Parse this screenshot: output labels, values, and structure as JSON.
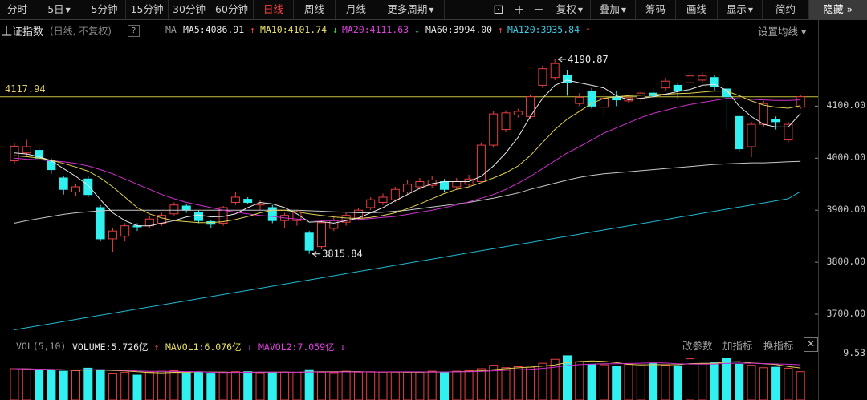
{
  "toolbar": {
    "tabs": [
      {
        "label": "分时",
        "dropdown": false,
        "active": false
      },
      {
        "label": "5日",
        "dropdown": true,
        "active": false
      },
      {
        "label": "5分钟",
        "dropdown": false,
        "active": false
      },
      {
        "label": "15分钟",
        "dropdown": false,
        "active": false
      },
      {
        "label": "30分钟",
        "dropdown": false,
        "active": false
      },
      {
        "label": "60分钟",
        "dropdown": false,
        "active": false
      },
      {
        "label": "日线",
        "dropdown": false,
        "active": true
      },
      {
        "label": "周线",
        "dropdown": false,
        "active": false
      },
      {
        "label": "月线",
        "dropdown": false,
        "active": false
      },
      {
        "label": "更多周期",
        "dropdown": true,
        "active": false
      }
    ],
    "tools": [
      {
        "label": "复权",
        "dropdown": true
      },
      {
        "label": "叠加",
        "dropdown": true
      },
      {
        "label": "筹码",
        "dropdown": false
      },
      {
        "label": "画线",
        "dropdown": false
      },
      {
        "label": "显示",
        "dropdown": true
      },
      {
        "label": "简约",
        "dropdown": false
      }
    ],
    "hide_label": "隐藏",
    "hide_arrows": "»"
  },
  "ma_bar": {
    "index_name": "上证指数",
    "mode": "(日线, 不复权)",
    "help": "?",
    "ma_title": "MA",
    "ma5": {
      "text": "MA5:4086.91",
      "arrow": "↑",
      "color": "#e8e8e8"
    },
    "ma10": {
      "text": "MA10:4101.74",
      "arrow": "↓",
      "color": "#e8e060"
    },
    "ma20": {
      "text": "MA20:4111.63",
      "arrow": "↓",
      "color": "#e040e0"
    },
    "ma60": {
      "text": "MA60:3994.00",
      "arrow": "↑",
      "color": "#e8e8e8"
    },
    "ma120": {
      "text": "MA120:3935.84",
      "arrow": "↑",
      "color": "#38d0e8"
    },
    "settings": "设置均线 ▾"
  },
  "price_line_label": "4117.94",
  "annotations": {
    "high": "4190.87",
    "low": "3815.84"
  },
  "y_axis": {
    "ticks": [
      "4100.00",
      "4000.00",
      "3900.00",
      "3800.00",
      "3700.00"
    ],
    "vol_tick": "9.53"
  },
  "vol_bar": {
    "title": "VOL(5,10)",
    "volume": {
      "text": "VOLUME:5.726亿",
      "arrow": "↑"
    },
    "mavol1": {
      "text": "MAVOL1:6.076亿",
      "arrow": "↓"
    },
    "mavol2": {
      "text": "MAVOL2:7.059亿",
      "arrow": "↓"
    },
    "buttons": [
      "改参数",
      "加指标",
      "换指标"
    ],
    "close": "✕"
  },
  "colors": {
    "up": "#e84040",
    "down": "#30f0f0",
    "ma5": "#e8e8e8",
    "ma10": "#e0d050",
    "ma20": "#d030d0",
    "ma60": "#c8c8c8",
    "ma120": "#20b8d0",
    "price_line": "#c8c040"
  },
  "chart_data": {
    "type": "candlestick",
    "ylim": [
      3660,
      4230
    ],
    "candles": [
      {
        "o": 3995,
        "c": 4023,
        "h": 4028,
        "l": 3990
      },
      {
        "o": 4010,
        "c": 4022,
        "h": 4035,
        "l": 4005
      },
      {
        "o": 4015,
        "c": 4000,
        "h": 4020,
        "l": 3995
      },
      {
        "o": 3995,
        "c": 3978,
        "h": 4000,
        "l": 3970
      },
      {
        "o": 3962,
        "c": 3940,
        "h": 3965,
        "l": 3930
      },
      {
        "o": 3935,
        "c": 3945,
        "h": 3950,
        "l": 3928
      },
      {
        "o": 3960,
        "c": 3930,
        "h": 3965,
        "l": 3925
      },
      {
        "o": 3905,
        "c": 3845,
        "h": 3910,
        "l": 3840
      },
      {
        "o": 3845,
        "c": 3860,
        "h": 3865,
        "l": 3820
      },
      {
        "o": 3850,
        "c": 3870,
        "h": 3875,
        "l": 3840
      },
      {
        "o": 3870,
        "c": 3868,
        "h": 3875,
        "l": 3860
      },
      {
        "o": 3870,
        "c": 3883,
        "h": 3890,
        "l": 3865
      },
      {
        "o": 3875,
        "c": 3890,
        "h": 3895,
        "l": 3870
      },
      {
        "o": 3893,
        "c": 3910,
        "h": 3915,
        "l": 3890
      },
      {
        "o": 3908,
        "c": 3900,
        "h": 3912,
        "l": 3895
      },
      {
        "o": 3895,
        "c": 3880,
        "h": 3900,
        "l": 3875
      },
      {
        "o": 3878,
        "c": 3873,
        "h": 3882,
        "l": 3866
      },
      {
        "o": 3875,
        "c": 3905,
        "h": 3908,
        "l": 3870
      },
      {
        "o": 3915,
        "c": 3925,
        "h": 3935,
        "l": 3910
      },
      {
        "o": 3921,
        "c": 3915,
        "h": 3925,
        "l": 3912
      },
      {
        "o": 3910,
        "c": 3912,
        "h": 3920,
        "l": 3900
      },
      {
        "o": 3905,
        "c": 3880,
        "h": 3910,
        "l": 3875
      },
      {
        "o": 3880,
        "c": 3890,
        "h": 3895,
        "l": 3866
      },
      {
        "o": 3880,
        "c": 3897,
        "h": 3900,
        "l": 3870
      },
      {
        "o": 3856,
        "c": 3823,
        "h": 3860,
        "l": 3816
      },
      {
        "o": 3830,
        "c": 3876,
        "h": 3880,
        "l": 3825
      },
      {
        "o": 3865,
        "c": 3880,
        "h": 3890,
        "l": 3860
      },
      {
        "o": 3877,
        "c": 3890,
        "h": 3895,
        "l": 3870
      },
      {
        "o": 3885,
        "c": 3900,
        "h": 3905,
        "l": 3880
      },
      {
        "o": 3905,
        "c": 3920,
        "h": 3925,
        "l": 3900
      },
      {
        "o": 3915,
        "c": 3925,
        "h": 3932,
        "l": 3910
      },
      {
        "o": 3920,
        "c": 3940,
        "h": 3945,
        "l": 3915
      },
      {
        "o": 3935,
        "c": 3950,
        "h": 3958,
        "l": 3930
      },
      {
        "o": 3945,
        "c": 3955,
        "h": 3962,
        "l": 3940
      },
      {
        "o": 3948,
        "c": 3958,
        "h": 3965,
        "l": 3942
      },
      {
        "o": 3955,
        "c": 3940,
        "h": 3960,
        "l": 3935
      },
      {
        "o": 3945,
        "c": 3955,
        "h": 3962,
        "l": 3940
      },
      {
        "o": 3950,
        "c": 3960,
        "h": 3968,
        "l": 3946
      },
      {
        "o": 3955,
        "c": 4025,
        "h": 4030,
        "l": 3955
      },
      {
        "o": 4025,
        "c": 4085,
        "h": 4090,
        "l": 4020
      },
      {
        "o": 4055,
        "c": 4087,
        "h": 4092,
        "l": 4050
      },
      {
        "o": 4083,
        "c": 4090,
        "h": 4095,
        "l": 4078
      },
      {
        "o": 4080,
        "c": 4118,
        "h": 4122,
        "l": 4075
      },
      {
        "o": 4140,
        "c": 4172,
        "h": 4178,
        "l": 4135
      },
      {
        "o": 4155,
        "c": 4182,
        "h": 4190,
        "l": 4150
      },
      {
        "o": 4160,
        "c": 4145,
        "h": 4170,
        "l": 4120
      },
      {
        "o": 4105,
        "c": 4117,
        "h": 4125,
        "l": 4100
      },
      {
        "o": 4128,
        "c": 4100,
        "h": 4135,
        "l": 4095
      },
      {
        "o": 4098,
        "c": 4115,
        "h": 4120,
        "l": 4080
      },
      {
        "o": 4118,
        "c": 4112,
        "h": 4130,
        "l": 4100
      },
      {
        "o": 4110,
        "c": 4116,
        "h": 4122,
        "l": 4105
      },
      {
        "o": 4115,
        "c": 4125,
        "h": 4130,
        "l": 4108
      },
      {
        "o": 4125,
        "c": 4120,
        "h": 4135,
        "l": 4115
      },
      {
        "o": 4135,
        "c": 4148,
        "h": 4155,
        "l": 4130
      },
      {
        "o": 4140,
        "c": 4130,
        "h": 4145,
        "l": 4115
      },
      {
        "o": 4145,
        "c": 4158,
        "h": 4162,
        "l": 4140
      },
      {
        "o": 4150,
        "c": 4158,
        "h": 4165,
        "l": 4145
      },
      {
        "o": 4155,
        "c": 4138,
        "h": 4160,
        "l": 4130
      },
      {
        "o": 4133,
        "c": 4118,
        "h": 4135,
        "l": 4055
      },
      {
        "o": 4080,
        "c": 4018,
        "h": 4082,
        "l": 4012
      },
      {
        "o": 4022,
        "c": 4065,
        "h": 4070,
        "l": 4002
      },
      {
        "o": 4065,
        "c": 4105,
        "h": 4110,
        "l": 4060
      },
      {
        "o": 4075,
        "c": 4070,
        "h": 4080,
        "l": 4055
      },
      {
        "o": 4035,
        "c": 4065,
        "h": 4070,
        "l": 4030
      },
      {
        "o": 4098,
        "c": 4118,
        "h": 4122,
        "l": 4095
      }
    ],
    "volume": [
      6.3,
      6.2,
      6.1,
      6.0,
      5.8,
      5.9,
      6.4,
      6.1,
      5.4,
      5.6,
      5.0,
      5.6,
      5.8,
      5.9,
      5.5,
      5.6,
      5.4,
      5.6,
      5.7,
      5.7,
      5.5,
      5.5,
      5.6,
      5.6,
      6.1,
      5.6,
      5.5,
      5.8,
      5.6,
      5.7,
      5.6,
      5.6,
      5.6,
      5.6,
      5.8,
      5.6,
      5.8,
      5.9,
      6.3,
      7.0,
      6.5,
      6.7,
      6.6,
      7.4,
      8.2,
      8.9,
      7.7,
      7.1,
      7.1,
      6.8,
      7.2,
      7.1,
      7.4,
      7.0,
      6.9,
      8.3,
      7.3,
      7.5,
      8.4,
      7.2,
      7.0,
      6.5,
      6.6,
      6.4,
      5.7
    ],
    "vol_ylim": [
      0,
      9.53
    ],
    "ma5": [
      4010,
      4008,
      4003,
      3995,
      3980,
      3965,
      3948,
      3920,
      3895,
      3880,
      3870,
      3870,
      3875,
      3880,
      3887,
      3891,
      3887,
      3888,
      3893,
      3905,
      3915,
      3912,
      3905,
      3893,
      3877,
      3878,
      3875,
      3880,
      3885,
      3895,
      3905,
      3918,
      3930,
      3942,
      3951,
      3955,
      3955,
      3955,
      3965,
      3985,
      4010,
      4040,
      4080,
      4115,
      4140,
      4150,
      4145,
      4140,
      4135,
      4120,
      4112,
      4115,
      4118,
      4123,
      4128,
      4132,
      4140,
      4142,
      4130,
      4100,
      4080,
      4065,
      4060,
      4060,
      4086
    ],
    "ma10": [
      4005,
      4003,
      4000,
      3996,
      3990,
      3983,
      3975,
      3962,
      3945,
      3925,
      3905,
      3893,
      3885,
      3880,
      3878,
      3876,
      3876,
      3878,
      3882,
      3888,
      3895,
      3900,
      3900,
      3897,
      3893,
      3890,
      3887,
      3885,
      3884,
      3886,
      3890,
      3895,
      3903,
      3912,
      3922,
      3932,
      3940,
      3945,
      3953,
      3962,
      3972,
      3985,
      4005,
      4030,
      4055,
      4075,
      4090,
      4105,
      4115,
      4118,
      4120,
      4121,
      4122,
      4123,
      4124,
      4125,
      4127,
      4129,
      4129,
      4120,
      4110,
      4102,
      4098,
      4096,
      4101
    ],
    "ma20": [
      4000,
      3998,
      3997,
      3995,
      3993,
      3990,
      3985,
      3978,
      3970,
      3960,
      3950,
      3940,
      3930,
      3922,
      3915,
      3910,
      3905,
      3900,
      3896,
      3893,
      3890,
      3888,
      3885,
      3883,
      3881,
      3880,
      3880,
      3881,
      3882,
      3884,
      3886,
      3888,
      3892,
      3896,
      3900,
      3905,
      3910,
      3916,
      3923,
      3930,
      3940,
      3952,
      3965,
      3980,
      3995,
      4010,
      4022,
      4035,
      4048,
      4058,
      4068,
      4078,
      4086,
      4092,
      4098,
      4103,
      4107,
      4111,
      4115,
      4114,
      4113,
      4112,
      4111,
      4111,
      4112
    ],
    "ma60": [
      3875,
      3880,
      3884,
      3888,
      3892,
      3895,
      3897,
      3899,
      3900,
      3900,
      3900,
      3900,
      3900,
      3900,
      3900,
      3900,
      3900,
      3900,
      3900,
      3900,
      3900,
      3900,
      3900,
      3900,
      3899,
      3898,
      3897,
      3896,
      3895,
      3895,
      3896,
      3898,
      3900,
      3903,
      3906,
      3909,
      3912,
      3915,
      3919,
      3923,
      3928,
      3933,
      3940,
      3946,
      3952,
      3958,
      3963,
      3967,
      3970,
      3972,
      3974,
      3976,
      3978,
      3980,
      3982,
      3984,
      3986,
      3988,
      3989,
      3990,
      3991,
      3991,
      3992,
      3993,
      3994
    ],
    "ma120": [
      3670,
      3674,
      3678,
      3682,
      3686,
      3690,
      3694,
      3698,
      3702,
      3706,
      3710,
      3714,
      3718,
      3722,
      3726,
      3730,
      3734,
      3738,
      3742,
      3746,
      3750,
      3754,
      3758,
      3762,
      3766,
      3770,
      3774,
      3778,
      3782,
      3786,
      3790,
      3794,
      3798,
      3802,
      3806,
      3810,
      3814,
      3818,
      3822,
      3826,
      3830,
      3834,
      3838,
      3842,
      3846,
      3850,
      3854,
      3858,
      3862,
      3866,
      3870,
      3874,
      3878,
      3882,
      3886,
      3890,
      3894,
      3898,
      3902,
      3906,
      3910,
      3914,
      3918,
      3922,
      3936
    ]
  }
}
